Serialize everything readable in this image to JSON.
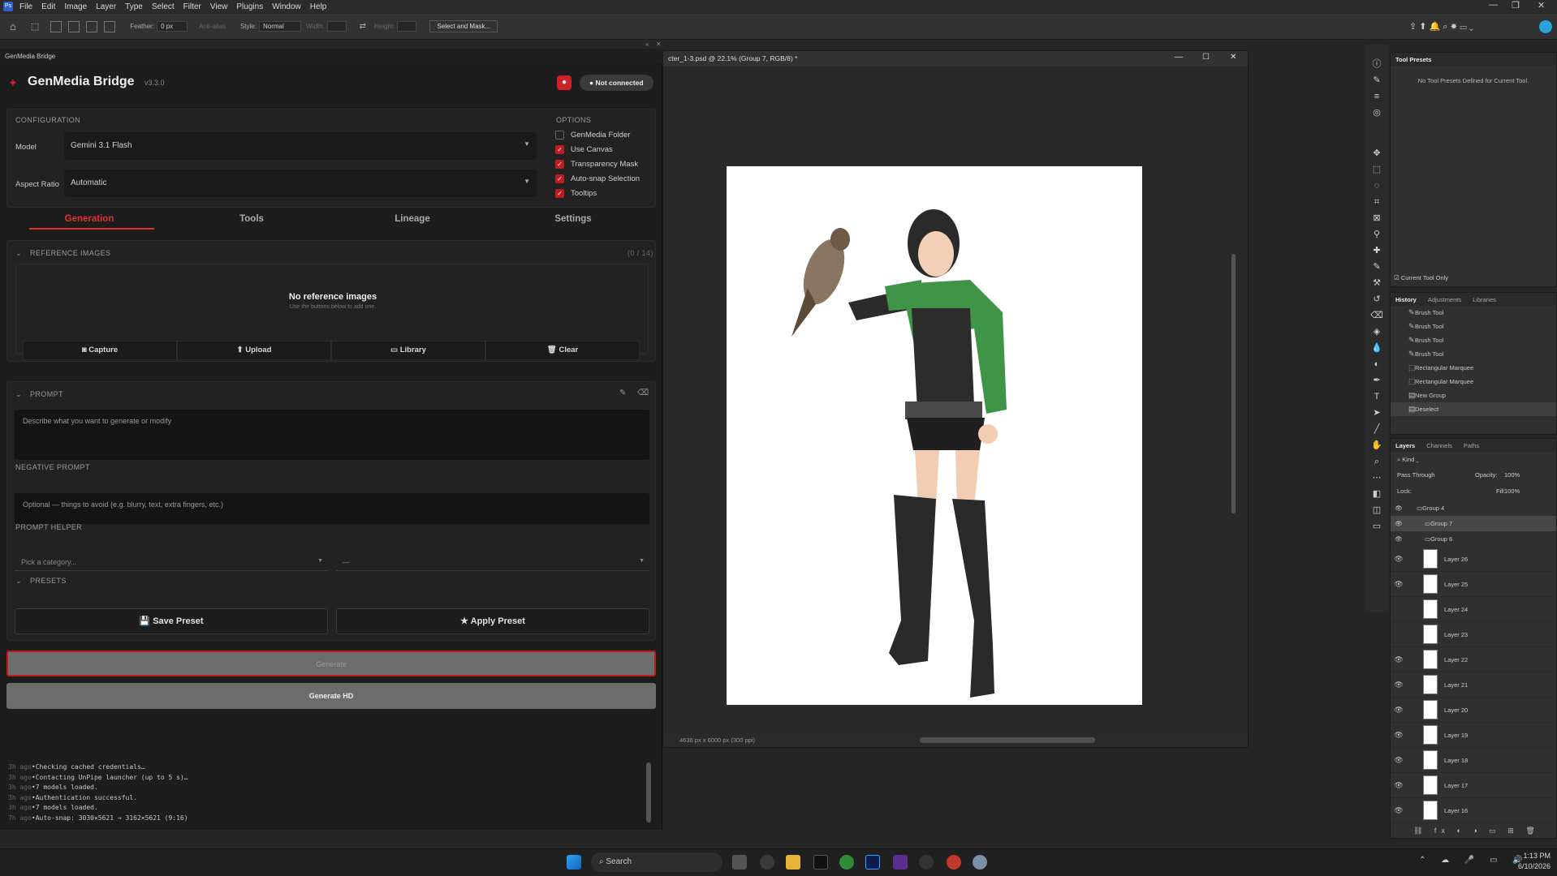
{
  "menubar": {
    "items": [
      "File",
      "Edit",
      "Image",
      "Layer",
      "Type",
      "Select",
      "Filter",
      "View",
      "Plugins",
      "Window",
      "Help"
    ]
  },
  "optionsbar": {
    "feather_label": "Feather:",
    "feather_value": "0 px",
    "antialias": "Anti-alias",
    "style_label": "Style:",
    "style_value": "Normal",
    "width_label": "Width:",
    "height_label": "Height:",
    "select_mask": "Select and Mask..."
  },
  "plugin": {
    "tab_label": "GenMedia Bridge",
    "title": "GenMedia Bridge",
    "version": "v3.3.0",
    "status": "Not connected",
    "config_header": "CONFIGURATION",
    "options_header": "OPTIONS",
    "model_label": "Model",
    "model_value": "Gemini 3.1 Flash",
    "aspect_label": "Aspect Ratio",
    "aspect_value": "Automatic",
    "options": [
      {
        "label": "GenMedia Folder",
        "checked": false
      },
      {
        "label": "Use Canvas",
        "checked": true
      },
      {
        "label": "Transparency Mask",
        "checked": true
      },
      {
        "label": "Auto-snap Selection",
        "checked": true
      },
      {
        "label": "Tooltips",
        "checked": true
      }
    ],
    "tabs": [
      "Generation",
      "Tools",
      "Lineage",
      "Settings"
    ],
    "ref_header": "REFERENCE IMAGES",
    "ref_count": "(0 / 14)",
    "ref_empty_title": "No reference images",
    "ref_empty_sub": "Use the buttons below to add one.",
    "ref_buttons": [
      "Capture",
      "Upload",
      "Library",
      "Clear"
    ],
    "prompt_header": "PROMPT",
    "prompt_placeholder": "Describe what you want to generate or modify",
    "neg_header": "NEGATIVE PROMPT",
    "neg_placeholder": "Optional — things to avoid (e.g. blurry, text, extra fingers, etc.)",
    "helper_header": "PROMPT HELPER",
    "helper_category": "Pick a category...",
    "helper_sub": "—",
    "presets_header": "PRESETS",
    "save_preset": "Save Preset",
    "apply_preset": "Apply Preset",
    "generate": "Generate",
    "generate_hd": "Generate HD",
    "log": [
      {
        "t": "3h ago",
        "m": "Checking cached credentials…"
      },
      {
        "t": "3h ago",
        "m": "Contacting UnPipe launcher (up to 5 s)…"
      },
      {
        "t": "3h ago",
        "m": "7 models loaded."
      },
      {
        "t": "3h ago",
        "m": "Authentication successful."
      },
      {
        "t": "3h ago",
        "m": "7 models loaded."
      },
      {
        "t": "7h ago",
        "m": "Auto-snap: 3030×5621 → 3162×5621 (9:16)"
      }
    ]
  },
  "document": {
    "title": "cter_1-3.psd @ 22.1% (Group 7, RGB/8) *",
    "status": "4636 px x 6000 px (300 ppi)"
  },
  "toolpresets": {
    "tab": "Tool Presets",
    "empty": "No Tool Presets Defined for Current Tool.",
    "current_only": "Current Tool Only"
  },
  "history": {
    "tabs": [
      "History",
      "Adjustments",
      "Libraries"
    ],
    "items": [
      "Brush Tool",
      "Brush Tool",
      "Brush Tool",
      "Brush Tool",
      "Rectangular Marquee",
      "Rectangular Marquee",
      "New Group",
      "Deselect"
    ]
  },
  "layers": {
    "tabs": [
      "Layers",
      "Channels",
      "Paths"
    ],
    "kind": "Kind",
    "blend": "Pass Through",
    "opacity_label": "Opacity:",
    "opacity": "100%",
    "lock_label": "Lock:",
    "fill_label": "Fill:",
    "fill": "100%",
    "groups": [
      "Group 4",
      "Group 7",
      "Group 6"
    ],
    "items": [
      "Layer 26",
      "Layer 25",
      "Layer 24",
      "Layer 23",
      "Layer 22",
      "Layer 21",
      "Layer 20",
      "Layer 19",
      "Layer 18",
      "Layer 17",
      "Layer 16"
    ]
  },
  "taskbar": {
    "search": "Search",
    "time": "1:13 PM",
    "date": "6/10/2026"
  },
  "colors": {
    "accent": "#c11b22",
    "panel": "#1d1d1d"
  }
}
